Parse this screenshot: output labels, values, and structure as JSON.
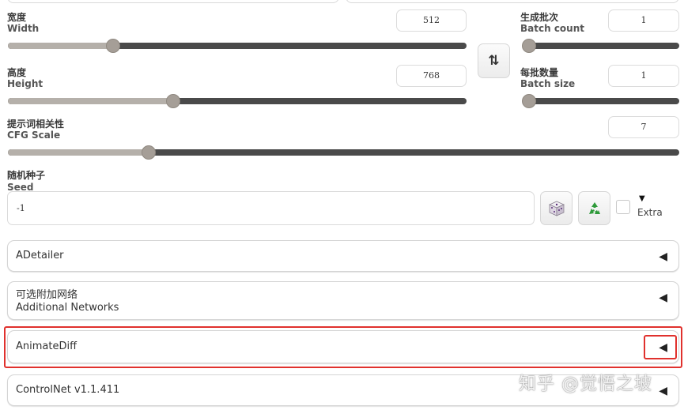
{
  "width": {
    "label_zh": "宽度",
    "label_en": "Width",
    "value": "512",
    "slider_fraction": 0.23
  },
  "height": {
    "label_zh": "高度",
    "label_en": "Height",
    "value": "768",
    "slider_fraction": 0.36
  },
  "swap_button": {
    "icon": "swap-vertical-icon",
    "glyph": "⇅"
  },
  "batch_count": {
    "label_zh": "生成批次",
    "label_en": "Batch count",
    "value": "1",
    "slider_fraction": 0.0
  },
  "batch_size": {
    "label_zh": "每批数量",
    "label_en": "Batch size",
    "value": "1",
    "slider_fraction": 0.0
  },
  "cfg_scale": {
    "label_zh": "提示词相关性",
    "label_en": "CFG Scale",
    "value": "7",
    "slider_fraction": 0.21
  },
  "seed": {
    "label_zh": "随机种子",
    "label_en": "Seed",
    "value": "-1",
    "dice_icon": "dice-icon",
    "recycle_icon": "recycle-icon",
    "extra_label": "Extra",
    "extra_arrow": "▼"
  },
  "panels": [
    {
      "title": "ADetailer",
      "arrow": "◀"
    },
    {
      "title_zh": "可选附加网络",
      "title_en": "Additional Networks",
      "arrow": "◀"
    },
    {
      "title": "AnimateDiff",
      "arrow": "◀"
    },
    {
      "title": "ControlNet v1.1.411",
      "arrow": "◀"
    }
  ],
  "watermark": "知乎 @觉悟之坡",
  "colors": {
    "highlight": "#e0312d",
    "slider_track": "#4a4a4a",
    "slider_fill": "#b5b0aa",
    "recycle_green": "#2e9a3a"
  }
}
